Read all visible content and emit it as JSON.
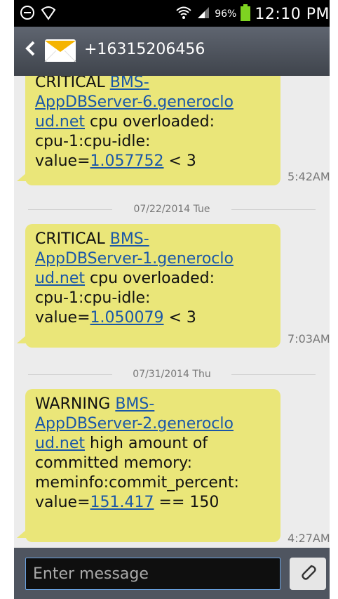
{
  "status_bar": {
    "battery_percent": "96%",
    "time": "12:10 PM",
    "icons": [
      "no-sim-icon",
      "wifi-outline-icon",
      "wifi-icon",
      "signal-icon",
      "battery-icon"
    ]
  },
  "header": {
    "contact": "+16315206456"
  },
  "messages": [
    {
      "parts": [
        {
          "t": "CRITICAL "
        },
        {
          "link": "BMS-\nAppDBServer-6.generoclo\nud.net"
        },
        {
          "t": " cpu overloaded:\ncpu-1:cpu-idle:\nvalue="
        },
        {
          "link": "1.057752"
        },
        {
          "t": " < 3"
        }
      ],
      "time": "5:42AM"
    },
    {
      "divider": "07/22/2014 Tue"
    },
    {
      "parts": [
        {
          "t": "CRITICAL "
        },
        {
          "link": "BMS-\nAppDBServer-1.generoclo\nud.net"
        },
        {
          "t": " cpu overloaded:\ncpu-1:cpu-idle:\nvalue="
        },
        {
          "link": "1.050079"
        },
        {
          "t": " < 3"
        }
      ],
      "time": "7:03AM"
    },
    {
      "divider": "07/31/2014 Thu"
    },
    {
      "parts": [
        {
          "t": "WARNING "
        },
        {
          "link": "BMS-\nAppDBServer-2.generoclo\nud.net"
        },
        {
          "t": " high amount of\ncommitted memory:\nmeminfo:commit_percent:\nvalue="
        },
        {
          "link": "151.417"
        },
        {
          "t": " == 150"
        }
      ],
      "time": "4:27AM"
    }
  ],
  "composer": {
    "placeholder": "Enter message",
    "attach_icon": "paperclip-icon"
  }
}
